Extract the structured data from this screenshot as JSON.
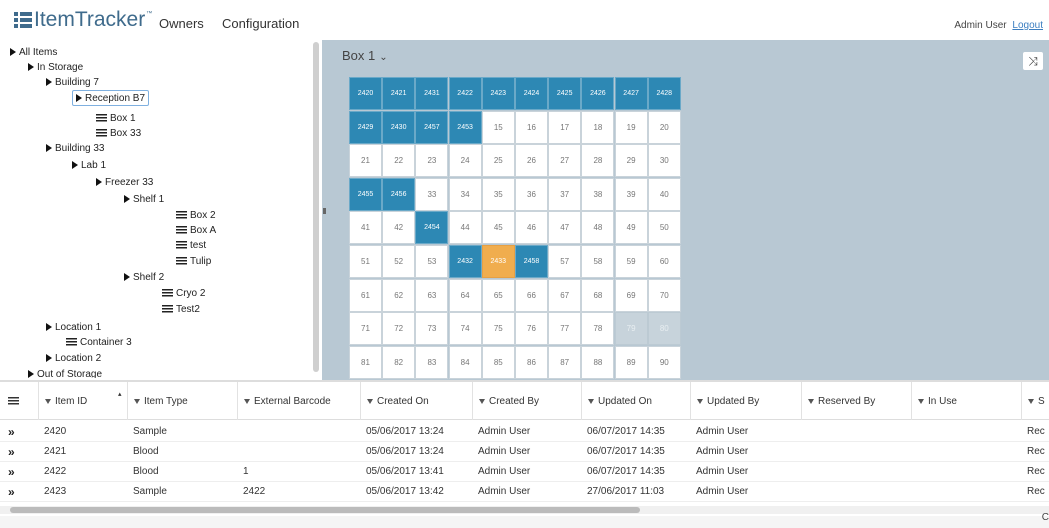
{
  "header": {
    "logo_text": "ItemTracker",
    "logo_tm": "™",
    "nav": [
      "Owners",
      "Configuration"
    ],
    "user": "Admin User",
    "logout": "Logout"
  },
  "tree": [
    {
      "label": "All Items",
      "type": "folder",
      "selected": false
    },
    {
      "label": "In Storage",
      "type": "folder",
      "selected": false
    },
    {
      "label": "Building 7",
      "type": "folder",
      "selected": false
    },
    {
      "label": "Reception B7",
      "type": "folder",
      "selected": true
    },
    {
      "label": "Box 1",
      "type": "box",
      "selected": false
    },
    {
      "label": "Box 33",
      "type": "box",
      "selected": false
    },
    {
      "label": "Building 33",
      "type": "folder",
      "selected": false
    },
    {
      "label": "Lab 1",
      "type": "folder",
      "selected": false
    },
    {
      "label": "Freezer 33",
      "type": "folder",
      "selected": false
    },
    {
      "label": "Shelf 1",
      "type": "folder",
      "selected": false
    },
    {
      "label": "Box 2",
      "type": "box",
      "selected": false
    },
    {
      "label": "Box A",
      "type": "box",
      "selected": false
    },
    {
      "label": "test",
      "type": "box",
      "selected": false
    },
    {
      "label": "Tulip",
      "type": "box",
      "selected": false
    },
    {
      "label": "Shelf 2",
      "type": "folder",
      "selected": false
    },
    {
      "label": "Cryo 2",
      "type": "box",
      "selected": false
    },
    {
      "label": "Test2",
      "type": "box",
      "selected": false
    },
    {
      "label": "Location 1",
      "type": "folder",
      "selected": false
    },
    {
      "label": "Container 3",
      "type": "box",
      "selected": false
    },
    {
      "label": "Location 2",
      "type": "folder",
      "selected": false
    },
    {
      "label": "Out of Storage",
      "type": "folder",
      "selected": false
    }
  ],
  "box": {
    "title": "Box 1",
    "caret": "⌄",
    "shuffle_icon": "⤨",
    "rows": [
      [
        {
          "v": "2420",
          "s": "used"
        },
        {
          "v": "2421",
          "s": "used"
        },
        {
          "v": "2431",
          "s": "used"
        },
        {
          "v": "2422",
          "s": "used"
        },
        {
          "v": "2423",
          "s": "used"
        },
        {
          "v": "2424",
          "s": "used"
        },
        {
          "v": "2425",
          "s": "used"
        },
        {
          "v": "2426",
          "s": "used"
        },
        {
          "v": "2427",
          "s": "used"
        },
        {
          "v": "2428",
          "s": "used"
        }
      ],
      [
        {
          "v": "2429",
          "s": "used"
        },
        {
          "v": "2430",
          "s": "used"
        },
        {
          "v": "2457",
          "s": "used"
        },
        {
          "v": "2453",
          "s": "used"
        },
        {
          "v": "15",
          "s": ""
        },
        {
          "v": "16",
          "s": ""
        },
        {
          "v": "17",
          "s": ""
        },
        {
          "v": "18",
          "s": ""
        },
        {
          "v": "19",
          "s": ""
        },
        {
          "v": "20",
          "s": ""
        }
      ],
      [
        {
          "v": "21",
          "s": ""
        },
        {
          "v": "22",
          "s": ""
        },
        {
          "v": "23",
          "s": ""
        },
        {
          "v": "24",
          "s": ""
        },
        {
          "v": "25",
          "s": ""
        },
        {
          "v": "26",
          "s": ""
        },
        {
          "v": "27",
          "s": ""
        },
        {
          "v": "28",
          "s": ""
        },
        {
          "v": "29",
          "s": ""
        },
        {
          "v": "30",
          "s": ""
        }
      ],
      [
        {
          "v": "2455",
          "s": "used"
        },
        {
          "v": "2456",
          "s": "used"
        },
        {
          "v": "33",
          "s": ""
        },
        {
          "v": "34",
          "s": ""
        },
        {
          "v": "35",
          "s": ""
        },
        {
          "v": "36",
          "s": ""
        },
        {
          "v": "37",
          "s": ""
        },
        {
          "v": "38",
          "s": ""
        },
        {
          "v": "39",
          "s": ""
        },
        {
          "v": "40",
          "s": ""
        }
      ],
      [
        {
          "v": "41",
          "s": ""
        },
        {
          "v": "42",
          "s": ""
        },
        {
          "v": "2454",
          "s": "used"
        },
        {
          "v": "44",
          "s": ""
        },
        {
          "v": "45",
          "s": ""
        },
        {
          "v": "46",
          "s": ""
        },
        {
          "v": "47",
          "s": ""
        },
        {
          "v": "48",
          "s": ""
        },
        {
          "v": "49",
          "s": ""
        },
        {
          "v": "50",
          "s": ""
        }
      ],
      [
        {
          "v": "51",
          "s": ""
        },
        {
          "v": "52",
          "s": ""
        },
        {
          "v": "53",
          "s": ""
        },
        {
          "v": "2432",
          "s": "used"
        },
        {
          "v": "2433",
          "s": "hl"
        },
        {
          "v": "2458",
          "s": "used"
        },
        {
          "v": "57",
          "s": ""
        },
        {
          "v": "58",
          "s": ""
        },
        {
          "v": "59",
          "s": ""
        },
        {
          "v": "60",
          "s": ""
        }
      ],
      [
        {
          "v": "61",
          "s": ""
        },
        {
          "v": "62",
          "s": ""
        },
        {
          "v": "63",
          "s": ""
        },
        {
          "v": "64",
          "s": ""
        },
        {
          "v": "65",
          "s": ""
        },
        {
          "v": "66",
          "s": ""
        },
        {
          "v": "67",
          "s": ""
        },
        {
          "v": "68",
          "s": ""
        },
        {
          "v": "69",
          "s": ""
        },
        {
          "v": "70",
          "s": ""
        }
      ],
      [
        {
          "v": "71",
          "s": ""
        },
        {
          "v": "72",
          "s": ""
        },
        {
          "v": "73",
          "s": ""
        },
        {
          "v": "74",
          "s": ""
        },
        {
          "v": "75",
          "s": ""
        },
        {
          "v": "76",
          "s": ""
        },
        {
          "v": "77",
          "s": ""
        },
        {
          "v": "78",
          "s": ""
        },
        {
          "v": "79",
          "s": "dim"
        },
        {
          "v": "80",
          "s": "dim"
        }
      ],
      [
        {
          "v": "81",
          "s": ""
        },
        {
          "v": "82",
          "s": ""
        },
        {
          "v": "83",
          "s": ""
        },
        {
          "v": "84",
          "s": ""
        },
        {
          "v": "85",
          "s": ""
        },
        {
          "v": "86",
          "s": ""
        },
        {
          "v": "87",
          "s": ""
        },
        {
          "v": "88",
          "s": ""
        },
        {
          "v": "89",
          "s": ""
        },
        {
          "v": "90",
          "s": ""
        }
      ]
    ]
  },
  "table": {
    "columns": [
      "Item ID",
      "Item Type",
      "External Barcode",
      "Created On",
      "Created By",
      "Updated On",
      "Updated By",
      "Reserved By",
      "In Use",
      "S"
    ],
    "rows": [
      [
        "2420",
        "Sample",
        "",
        "05/06/2017 13:24",
        "Admin User",
        "06/07/2017 14:35",
        "Admin User",
        "",
        "",
        "Rec"
      ],
      [
        "2421",
        "Blood",
        "",
        "05/06/2017 13:24",
        "Admin User",
        "06/07/2017 14:35",
        "Admin User",
        "",
        "",
        "Rec"
      ],
      [
        "2422",
        "Blood",
        "1",
        "05/06/2017 13:41",
        "Admin User",
        "06/07/2017 14:35",
        "Admin User",
        "",
        "",
        "Rec"
      ],
      [
        "2423",
        "Sample",
        "2422",
        "05/06/2017 13:42",
        "Admin User",
        "27/06/2017 11:03",
        "Admin User",
        "",
        "",
        "Rec"
      ]
    ],
    "expand_icon": "»",
    "sort_icon": "▴",
    "corner": "C"
  },
  "colors": {
    "brand": "#3f6b8c",
    "used_cell": "#2d88b4",
    "highlight_cell": "#f0ad4e",
    "panel_bg": "#b8c8d3"
  }
}
